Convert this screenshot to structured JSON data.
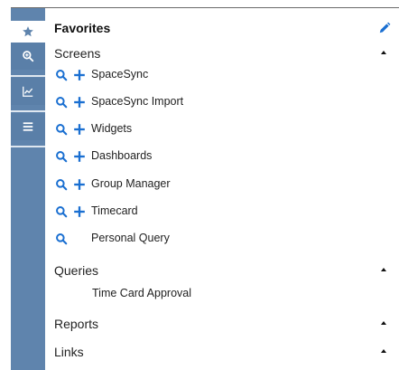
{
  "sidebar": {
    "items": [
      {
        "icon": "star-icon",
        "active": true
      },
      {
        "icon": "search-icon",
        "active": false
      },
      {
        "icon": "chart-icon",
        "active": false
      },
      {
        "icon": "menu-icon",
        "active": false
      }
    ],
    "colors": {
      "rail": "#5f84ad",
      "active_bg": "#ffffff",
      "accent": "#1a6fd1"
    }
  },
  "favorites": {
    "title": "Favorites",
    "edit_icon": "pencil-icon"
  },
  "screens": {
    "title": "Screens",
    "items": [
      {
        "label": "SpaceSync",
        "search": true,
        "add": true
      },
      {
        "label": "SpaceSync Import",
        "search": true,
        "add": true
      },
      {
        "label": "Widgets",
        "search": true,
        "add": true
      },
      {
        "label": "Dashboards",
        "search": true,
        "add": true
      },
      {
        "label": "Group Manager",
        "search": true,
        "add": true
      },
      {
        "label": "Timecard",
        "search": true,
        "add": true
      },
      {
        "label": "Personal Query",
        "search": true,
        "add": false
      }
    ]
  },
  "queries": {
    "title": "Queries",
    "items": [
      {
        "label": "Time Card Approval"
      }
    ]
  },
  "reports": {
    "title": "Reports"
  },
  "links": {
    "title": "Links"
  }
}
